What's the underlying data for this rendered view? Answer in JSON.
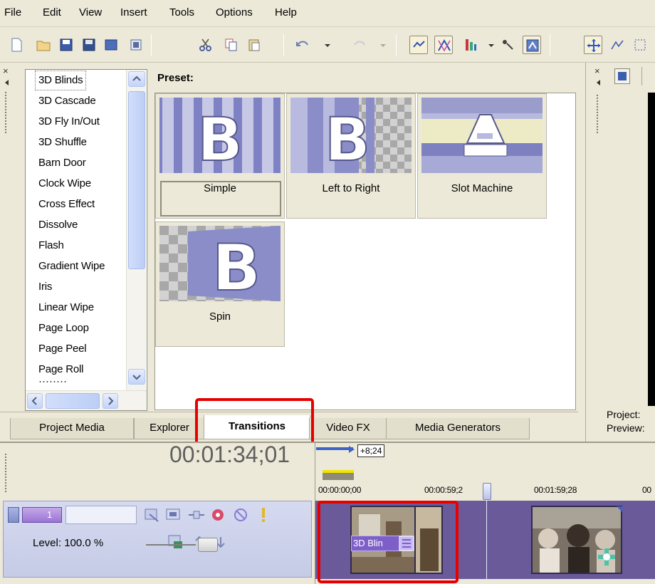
{
  "menu": {
    "file": "File",
    "edit": "Edit",
    "view": "View",
    "insert": "Insert",
    "tools": "Tools",
    "options": "Options",
    "help": "Help"
  },
  "transitions_list": {
    "items": [
      "3D Blinds",
      "3D Cascade",
      "3D Fly In/Out",
      "3D Shuffle",
      "Barn Door",
      "Clock Wipe",
      "Cross Effect",
      "Dissolve",
      "Flash",
      "Gradient Wipe",
      "Iris",
      "Linear Wipe",
      "Page Loop",
      "Page Peel",
      "Page Roll"
    ],
    "selected": "3D Blinds"
  },
  "preset": {
    "label": "Preset:",
    "items": [
      "Simple",
      "Left to Right",
      "Slot Machine",
      "Spin"
    ],
    "selected": "Simple"
  },
  "tabs": {
    "project_media": "Project Media",
    "explorer": "Explorer",
    "transitions": "Transitions",
    "video_fx": "Video FX",
    "media_generators": "Media Generators",
    "active": "Transitions"
  },
  "preview": {
    "project_label": "Project:",
    "preview_label": "Preview:"
  },
  "timeline": {
    "timecode": "00:01:34;01",
    "rate": "+8;24",
    "track_number": "1",
    "level_label": "Level: 100.0 %",
    "level_value": 100.0,
    "ruler": [
      "00:00:00;00",
      "00:00:59;2",
      "00:01:59;28",
      "00"
    ],
    "clip_transition_label": "3D Blin"
  },
  "colors": {
    "highlight": "#E60000",
    "track": "#6B5A9A",
    "background": "#ECE9D8"
  }
}
